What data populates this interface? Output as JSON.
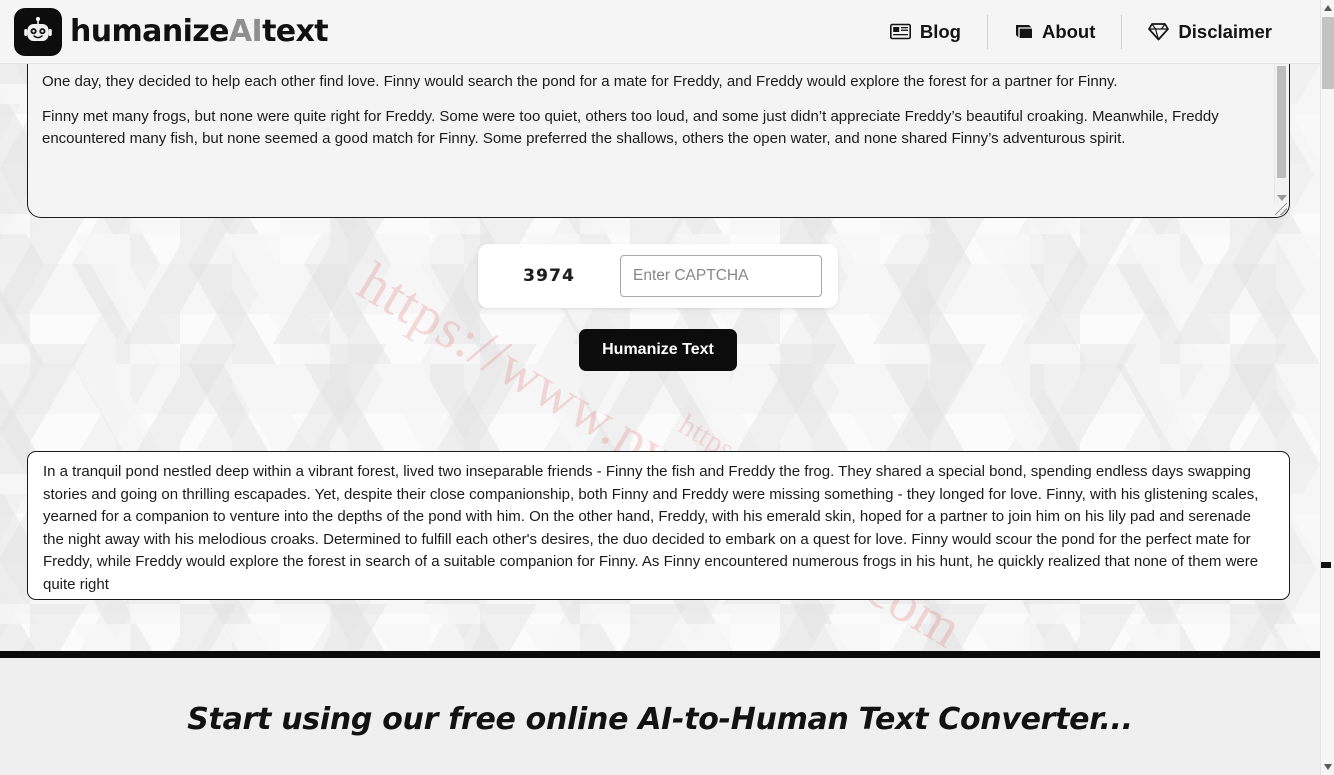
{
  "header": {
    "logo_icon": "robot-icon",
    "brand_prefix": "humanize",
    "brand_mid": "AI",
    "brand_suffix": "text",
    "nav": [
      {
        "label": "Blog",
        "icon": "newspaper-icon"
      },
      {
        "label": "About",
        "icon": "book-icon"
      },
      {
        "label": "Disclaimer",
        "icon": "diamond-icon"
      }
    ]
  },
  "watermark": {
    "primary": "https://www.pythonthree.com",
    "secondary": "https"
  },
  "input_area": {
    "paragraphs": [
      "One day, they decided to help each other find love. Finny would search the pond for a mate for Freddy, and Freddy would explore the forest for a partner for Finny.",
      "Finny met many frogs, but none were quite right for Freddy. Some were too quiet, others too loud, and some just didn’t appreciate Freddy’s beautiful croaking. Meanwhile, Freddy encountered many fish, but none seemed a good match for Finny. Some preferred the shallows, others the open water, and none shared Finny’s adventurous spirit."
    ]
  },
  "captcha": {
    "code": "3974",
    "placeholder": "Enter CAPTCHA",
    "value": ""
  },
  "actions": {
    "humanize_label": "Humanize Text"
  },
  "output_area": {
    "text": "In a tranquil pond nestled deep within a vibrant forest, lived two inseparable friends - Finny the fish and Freddy the frog. They shared a special bond, spending endless days swapping stories and going on thrilling escapades. Yet, despite their close companionship, both Finny and Freddy were missing something - they longed for love. Finny, with his glistening scales, yearned for a companion to venture into the depths of the pond with him. On the other hand, Freddy, with his emerald skin, hoped for a partner to join him on his lily pad and serenade the night away with his melodious croaks. Determined to fulfill each other's desires, the duo decided to embark on a quest for love. Finny would scour the pond for the perfect mate for Freddy, while Freddy would explore the forest in search of a suitable companion for Finny. As Finny encountered numerous frogs in his hunt, he quickly realized that none of them were quite right"
  },
  "footer": {
    "heading": "Start using our free online AI-to-Human Text Converter..."
  },
  "colors": {
    "accent_dark": "#0c0c0c",
    "header_bg": "#f5f5f5",
    "footer_bg": "#efefef",
    "watermark": "#e06060"
  }
}
